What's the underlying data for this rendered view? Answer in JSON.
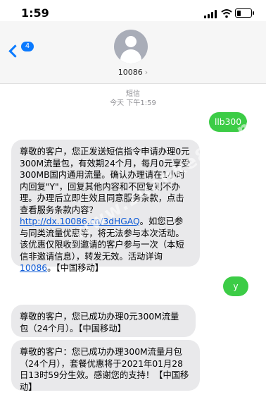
{
  "status_bar": {
    "time": "1:59",
    "battery_level": 0.3
  },
  "header": {
    "back_badge": "4",
    "contact": "10086"
  },
  "meta": {
    "service": "短信",
    "timestamp": "今天 下午1:59"
  },
  "messages": [
    {
      "direction": "outgoing",
      "text": "llb300"
    },
    {
      "direction": "incoming",
      "text_before_link": "尊敬的客户，您正发送短信指令申请办理0元300M流量包，有效期24个月，每月0元享受300MB国内通用流量。确认办理请在1小时内回复\"Y\"，回复其他内容和不回复则不办理。办理后立即生效且同意服务条款，点击查看服务条款内容？",
      "link": "http://dx.10086.cn/3dHGAQ",
      "text_after_link": "。如您已参与同类流量优惠等，将无法参与本次活动。该优惠仅限收到邀请的客户参与一次（本短信非邀请信息），转发无效。活动详询",
      "phone_link": "10086",
      "text_end": "。【中国移动】"
    },
    {
      "direction": "outgoing",
      "text": "y"
    },
    {
      "direction": "incoming",
      "text": "尊敬的客户，您已成功办理0元300M流量包（24个月）。【中国移动】"
    },
    {
      "direction": "incoming",
      "text": "尊敬的客户：您已成功办理300M流量月包（24个月），套餐优惠将于2021年01月28日13时59分生效。感谢您的支持！【中国移动】"
    }
  ],
  "watermark": "www.zuanke8.com",
  "colors": {
    "accent": "#0a7aff",
    "outgoing_bubble": "#3ccc46",
    "incoming_bubble": "#e9e9eb"
  }
}
